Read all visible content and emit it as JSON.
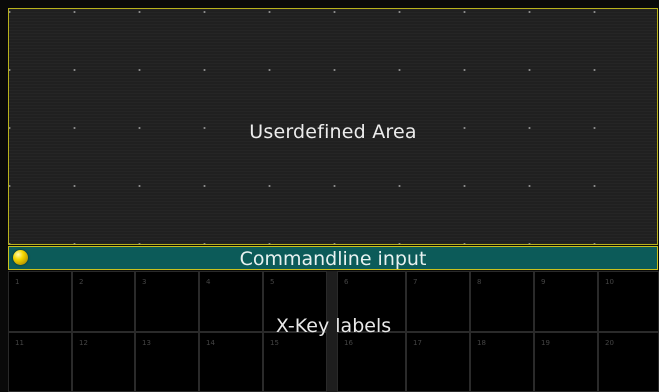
{
  "user_area": {
    "label": "Userdefined Area"
  },
  "commandline": {
    "label": "Commandline input",
    "status_color": "#f5d800",
    "bar_color": "#0c5b59",
    "border_color": "#c9c11d"
  },
  "xkeys": {
    "label": "X-Key labels",
    "row1": [
      "1",
      "2",
      "3",
      "4",
      "5",
      "6",
      "7",
      "8",
      "9",
      "10"
    ],
    "row2": [
      "11",
      "12",
      "13",
      "14",
      "15",
      "16",
      "17",
      "18",
      "19",
      "20"
    ]
  },
  "colors": {
    "frame_border": "#b8b21c",
    "area_background": "#202020"
  }
}
